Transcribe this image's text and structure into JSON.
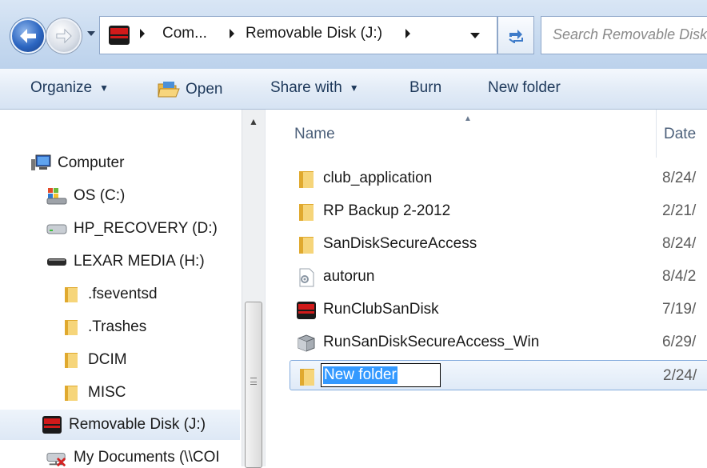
{
  "address_bar": {
    "crumbs": [
      "Com...",
      "Removable Disk (J:)"
    ],
    "search_placeholder": "Search Removable Disk (J:)"
  },
  "toolbar": {
    "organize": "Organize",
    "open": "Open",
    "share_with": "Share with",
    "burn": "Burn",
    "new_folder": "New folder"
  },
  "nav_pane": {
    "items": [
      {
        "label": "Computer",
        "icon": "computer-icon"
      },
      {
        "label": "OS (C:)",
        "icon": "windows-drive-icon"
      },
      {
        "label": "HP_RECOVERY (D:)",
        "icon": "drive-icon"
      },
      {
        "label": "LEXAR MEDIA (H:)",
        "icon": "removable-drive-icon"
      },
      {
        "label": ".fseventsd",
        "icon": "folder-icon"
      },
      {
        "label": ".Trashes",
        "icon": "folder-icon"
      },
      {
        "label": "DCIM",
        "icon": "folder-icon"
      },
      {
        "label": "MISC",
        "icon": "folder-icon"
      },
      {
        "label": "Removable Disk (J:)",
        "icon": "sandisk-drive-icon",
        "selected": true
      },
      {
        "label": "My Documents (\\\\COI",
        "icon": "network-drive-disconnected-icon"
      }
    ]
  },
  "columns": {
    "name": "Name",
    "date": "Date"
  },
  "files": [
    {
      "name": "club_application",
      "date": "8/24/",
      "icon": "folder-icon"
    },
    {
      "name": "RP Backup 2-2012",
      "date": "2/21/",
      "icon": "folder-icon"
    },
    {
      "name": "SanDiskSecureAccess",
      "date": "8/24/",
      "icon": "folder-icon"
    },
    {
      "name": "autorun",
      "date": "8/4/2",
      "icon": "settings-file-icon"
    },
    {
      "name": "RunClubSanDisk",
      "date": "7/19/",
      "icon": "sandisk-app-icon"
    },
    {
      "name": "RunSanDiskSecureAccess_Win",
      "date": "6/29/",
      "icon": "application-icon"
    },
    {
      "name": "New folder",
      "date": "2/24/",
      "icon": "folder-icon",
      "renaming": true
    }
  ],
  "colors": {
    "selection_blue": "#3399ff",
    "toolbar_text": "#1e395b",
    "header_text": "#4c607a"
  }
}
